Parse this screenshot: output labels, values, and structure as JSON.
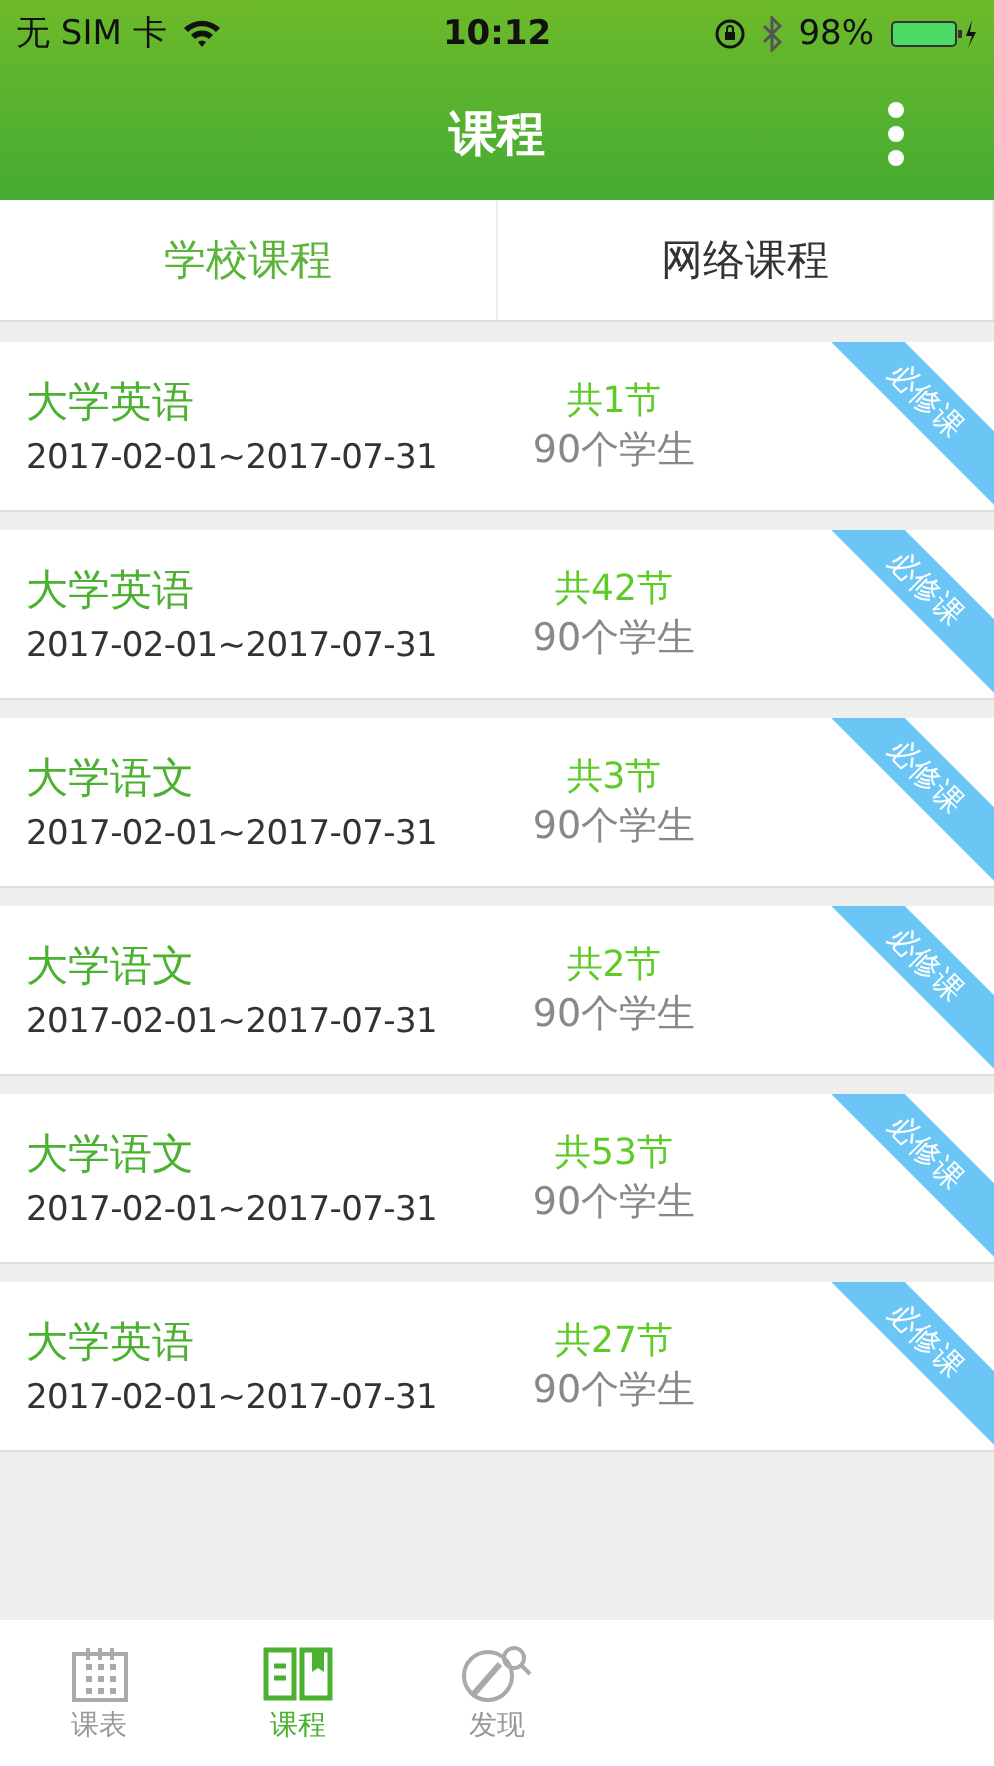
{
  "status_bar": {
    "carrier": "无 SIM 卡",
    "time": "10:12",
    "battery": "98%"
  },
  "nav": {
    "title": "课程"
  },
  "tabs": [
    {
      "label": "学校课程",
      "selected": true
    },
    {
      "label": "网络课程",
      "selected": false
    }
  ],
  "courses": [
    {
      "name": "大学英语",
      "dates": "2017-02-01~2017-07-31",
      "lessons": "共1节",
      "students": "90个学生",
      "ribbon": "必修课"
    },
    {
      "name": "大学英语",
      "dates": "2017-02-01~2017-07-31",
      "lessons": "共42节",
      "students": "90个学生",
      "ribbon": "必修课"
    },
    {
      "name": "大学语文",
      "dates": "2017-02-01~2017-07-31",
      "lessons": "共3节",
      "students": "90个学生",
      "ribbon": "必修课"
    },
    {
      "name": "大学语文",
      "dates": "2017-02-01~2017-07-31",
      "lessons": "共2节",
      "students": "90个学生",
      "ribbon": "必修课"
    },
    {
      "name": "大学语文",
      "dates": "2017-02-01~2017-07-31",
      "lessons": "共53节",
      "students": "90个学生",
      "ribbon": "必修课"
    },
    {
      "name": "大学英语",
      "dates": "2017-02-01~2017-07-31",
      "lessons": "共27节",
      "students": "90个学生",
      "ribbon": "必修课"
    }
  ],
  "bottom_tabs": [
    {
      "label": "课表",
      "kind": "calendar",
      "selected": false
    },
    {
      "label": "课程",
      "kind": "book",
      "selected": true
    },
    {
      "label": "发现",
      "kind": "discover",
      "selected": false
    }
  ]
}
